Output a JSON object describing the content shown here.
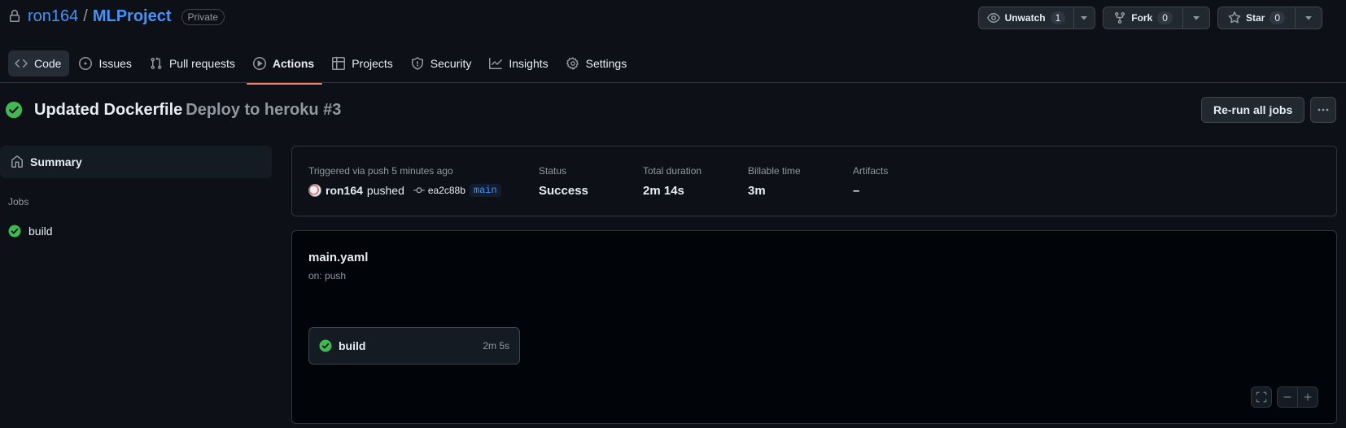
{
  "repo": {
    "owner": "ron164",
    "separator": "/",
    "name": "MLProject",
    "visibility": "Private",
    "icon": "lock-icon"
  },
  "header_actions": {
    "watch": {
      "label": "Unwatch",
      "count": "1",
      "icon": "eye-icon"
    },
    "fork": {
      "label": "Fork",
      "count": "0",
      "icon": "repo-forked-icon"
    },
    "star": {
      "label": "Star",
      "count": "0",
      "icon": "star-icon"
    }
  },
  "tabs": [
    {
      "label": "Code",
      "icon": "code-icon"
    },
    {
      "label": "Issues",
      "icon": "issue-opened-icon"
    },
    {
      "label": "Pull requests",
      "icon": "git-pull-request-icon"
    },
    {
      "label": "Actions",
      "icon": "play-icon",
      "active": true
    },
    {
      "label": "Projects",
      "icon": "table-icon"
    },
    {
      "label": "Security",
      "icon": "shield-icon"
    },
    {
      "label": "Insights",
      "icon": "graph-icon"
    },
    {
      "label": "Settings",
      "icon": "gear-icon"
    }
  ],
  "run": {
    "commit_message": "Updated Dockerfile",
    "workflow_label": "Deploy to heroku #3",
    "rerun_label": "Re-run all jobs",
    "status_icon": "check-circle-fill-icon"
  },
  "sidebar": {
    "summary_label": "Summary",
    "jobs_heading": "Jobs",
    "jobs": [
      {
        "label": "build",
        "status": "success"
      }
    ]
  },
  "summary": {
    "trigger_label": "Triggered via push 5 minutes ago",
    "actor": "ron164",
    "action": "pushed",
    "sha": "ea2c88b",
    "branch": "main",
    "status_label": "Status",
    "status_value": "Success",
    "duration_label": "Total duration",
    "duration_value": "2m 14s",
    "billable_label": "Billable time",
    "billable_value": "3m",
    "artifacts_label": "Artifacts",
    "artifacts_value": "–"
  },
  "graph": {
    "workflow_file": "main.yaml",
    "trigger": "on: push",
    "job": {
      "name": "build",
      "duration": "2m 5s"
    }
  },
  "colors": {
    "background": "#0d1117",
    "link": "#4493f8",
    "success": "#3fb950",
    "active_tab_underline": "#f78166"
  }
}
